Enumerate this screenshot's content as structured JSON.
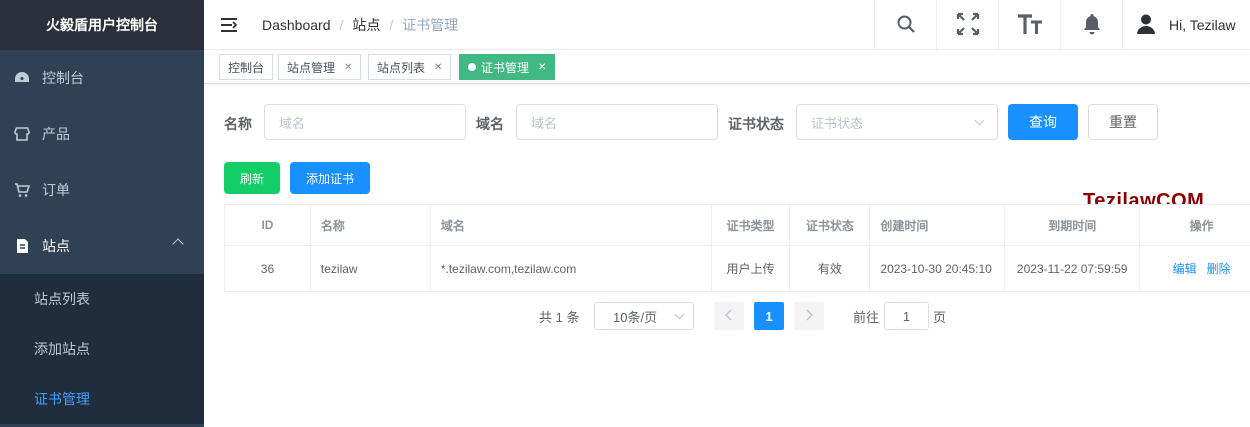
{
  "sidebar": {
    "logo": "火毅盾用户控制台",
    "items": [
      {
        "label": "控制台",
        "icon": "dashboard-icon"
      },
      {
        "label": "产品",
        "icon": "store-icon"
      },
      {
        "label": "订单",
        "icon": "cart-icon"
      },
      {
        "label": "站点",
        "icon": "site-icon"
      }
    ],
    "sub_items": [
      {
        "label": "站点列表"
      },
      {
        "label": "添加站点"
      },
      {
        "label": "证书管理"
      }
    ]
  },
  "navbar": {
    "breadcrumb": [
      "Dashboard",
      "站点",
      "证书管理"
    ],
    "user": "Hi, Tezilaw"
  },
  "tags": [
    {
      "label": "控制台"
    },
    {
      "label": "站点管理"
    },
    {
      "label": "站点列表"
    },
    {
      "label": "证书管理"
    }
  ],
  "filters": {
    "name_label": "名称",
    "name_placeholder": "域名",
    "domain_label": "域名",
    "domain_placeholder": "域名",
    "status_label": "证书状态",
    "status_placeholder": "证书状态",
    "search_button": "查询",
    "reset_button": "重置"
  },
  "actions": {
    "refresh": "刷新",
    "add_cert": "添加证书"
  },
  "watermark": "TezilawCOM",
  "table": {
    "headers": [
      "ID",
      "名称",
      "域名",
      "证书类型",
      "证书状态",
      "创建时间",
      "到期时间",
      "操作"
    ],
    "rows": [
      {
        "id": "36",
        "name": "tezilaw",
        "domain": "*.tezilaw.com,tezilaw.com",
        "type": "用户上传",
        "status": "有效",
        "created": "2023-10-30 20:45:10",
        "expires": "2023-11-22 07:59:59",
        "edit": "编辑",
        "delete": "删除"
      }
    ]
  },
  "pagination": {
    "total": "共 1 条",
    "page_size": "10条/页",
    "current": "1",
    "goto_label": "前往",
    "goto_value": "1",
    "goto_suffix": "页"
  },
  "colors": {
    "sidebar_bg": "#304156",
    "primary": "#1890ff",
    "success": "#13ce66",
    "tag_active": "#42b983",
    "watermark": "#8b0000"
  }
}
